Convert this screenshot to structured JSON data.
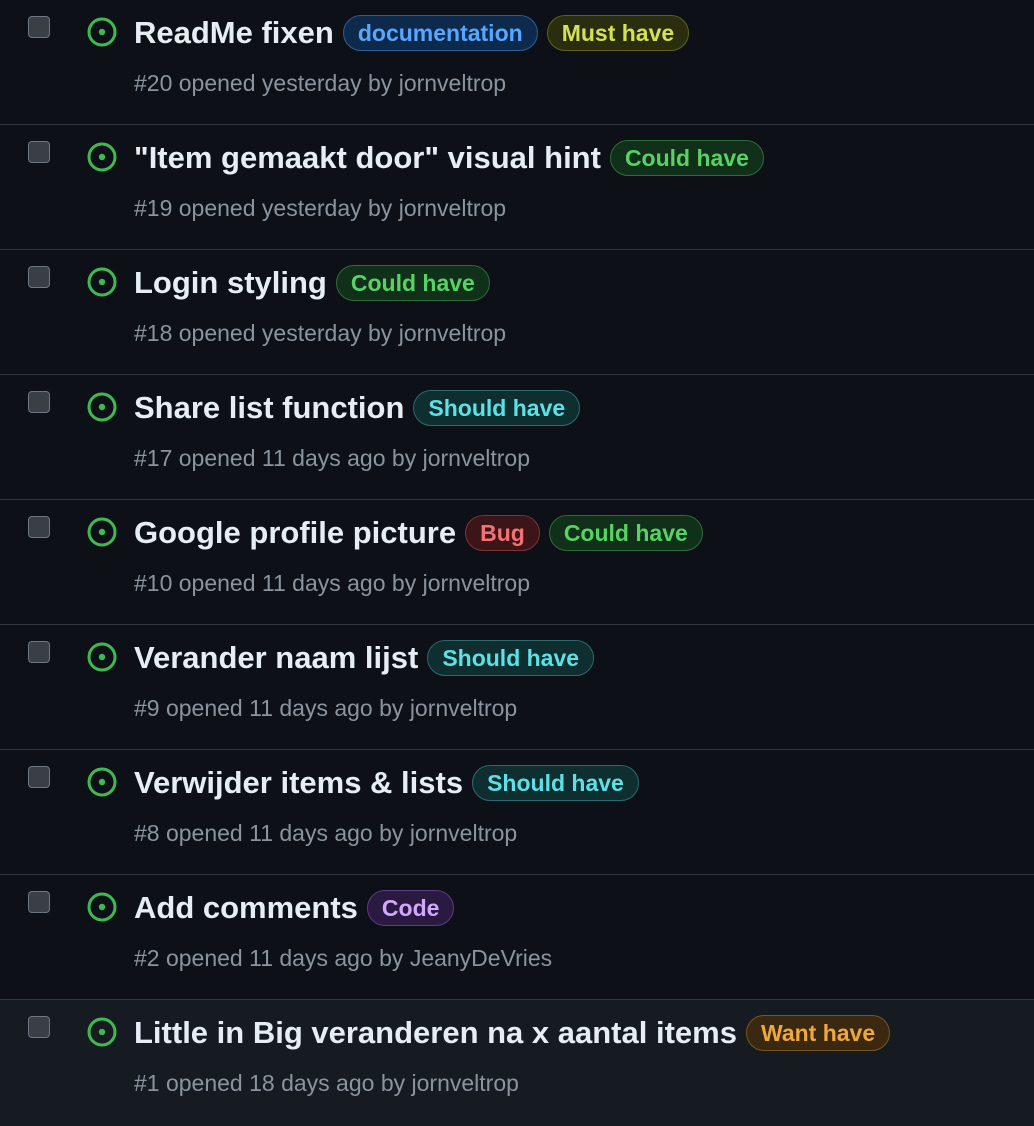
{
  "issues": [
    {
      "title": "ReadMe fixen",
      "labels": [
        {
          "text": "documentation",
          "fg": "#58a6ff",
          "bg": "#0d2a4d",
          "border": "#2f5d96"
        },
        {
          "text": "Must have",
          "fg": "#d4e157",
          "bg": "#2b2e0e",
          "border": "#5c6120"
        }
      ],
      "meta_prefix": "#20 opened yesterday by ",
      "author": "jornveltrop"
    },
    {
      "title": "\"Item gemaakt door\" visual hint",
      "labels": [
        {
          "text": "Could have",
          "fg": "#56d364",
          "bg": "#10301a",
          "border": "#2e6b3a"
        }
      ],
      "meta_prefix": "#19 opened yesterday by ",
      "author": "jornveltrop"
    },
    {
      "title": "Login styling",
      "labels": [
        {
          "text": "Could have",
          "fg": "#56d364",
          "bg": "#10301a",
          "border": "#2e6b3a"
        }
      ],
      "meta_prefix": "#18 opened yesterday by ",
      "author": "jornveltrop"
    },
    {
      "title": "Share list function",
      "labels": [
        {
          "text": "Should have",
          "fg": "#5ce1e6",
          "bg": "#0e2e30",
          "border": "#2c6a6e"
        }
      ],
      "meta_prefix": "#17 opened 11 days ago by ",
      "author": "jornveltrop"
    },
    {
      "title": "Google profile picture",
      "labels": [
        {
          "text": "Bug",
          "fg": "#f47174",
          "bg": "#3b1518",
          "border": "#7d3237"
        },
        {
          "text": "Could have",
          "fg": "#56d364",
          "bg": "#10301a",
          "border": "#2e6b3a"
        }
      ],
      "meta_prefix": "#10 opened 11 days ago by ",
      "author": "jornveltrop"
    },
    {
      "title": "Verander naam lijst",
      "labels": [
        {
          "text": "Should have",
          "fg": "#5ce1e6",
          "bg": "#0e2e30",
          "border": "#2c6a6e"
        }
      ],
      "meta_prefix": "#9 opened 11 days ago by ",
      "author": "jornveltrop"
    },
    {
      "title": "Verwijder items & lists",
      "labels": [
        {
          "text": "Should have",
          "fg": "#5ce1e6",
          "bg": "#0e2e30",
          "border": "#2c6a6e"
        }
      ],
      "meta_prefix": "#8 opened 11 days ago by ",
      "author": "jornveltrop"
    },
    {
      "title": "Add comments",
      "labels": [
        {
          "text": "Code",
          "fg": "#d2a8ff",
          "bg": "#2a1940",
          "border": "#5a3b85"
        }
      ],
      "meta_prefix": "#2 opened 11 days ago by ",
      "author": "JeanyDeVries"
    },
    {
      "title": "Little in Big veranderen na x aantal items",
      "labels": [
        {
          "text": "Want have",
          "fg": "#f0a83a",
          "bg": "#3a2810",
          "border": "#7a5420"
        }
      ],
      "meta_prefix": "#1 opened 18 days ago by ",
      "author": "jornveltrop"
    }
  ],
  "icons": {
    "status": "issue-opened-icon",
    "status_color": "#3fb950"
  }
}
